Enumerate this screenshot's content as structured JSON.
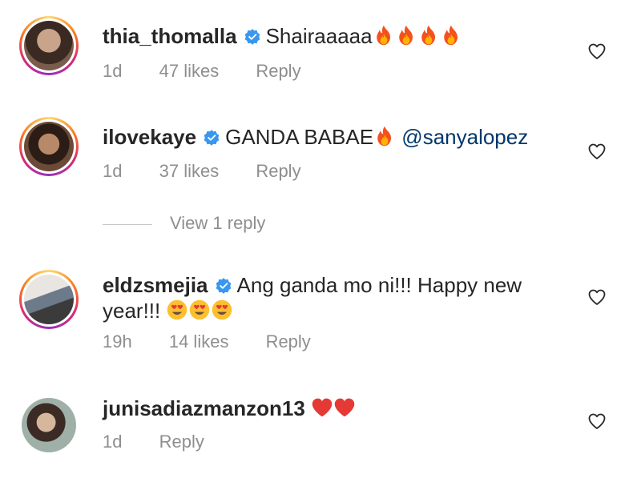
{
  "comments": [
    {
      "username": "thia_thomalla",
      "verified": true,
      "text": "Shairaaaaa",
      "emoji": [
        "fire",
        "fire",
        "fire",
        "fire"
      ],
      "time": "1d",
      "likes": "47 likes",
      "reply": "Reply",
      "has_ring": true
    },
    {
      "username": "ilovekaye",
      "verified": true,
      "text": "GANDA BABAE",
      "emoji": [
        "fire"
      ],
      "mention": "@sanyalopez",
      "time": "1d",
      "likes": "37 likes",
      "reply": "Reply",
      "has_ring": true
    },
    {
      "username": "eldzsmejia",
      "verified": true,
      "text": "Ang ganda mo ni!!! Happy new",
      "text_line2": "year!!!",
      "emoji": [
        "heart-eyes",
        "heart-eyes",
        "heart-eyes"
      ],
      "time": "19h",
      "likes": "14 likes",
      "reply": "Reply",
      "has_ring": true
    },
    {
      "username": "junisadiazmanzon13",
      "verified": false,
      "emoji": [
        "red-heart",
        "red-heart"
      ],
      "time": "1d",
      "reply": "Reply",
      "has_ring": false
    }
  ],
  "view_replies": "View 1 reply",
  "colors": {
    "verified_blue": "#3897f0",
    "mention": "#00376b",
    "meta_gray": "#8e8e8e"
  }
}
